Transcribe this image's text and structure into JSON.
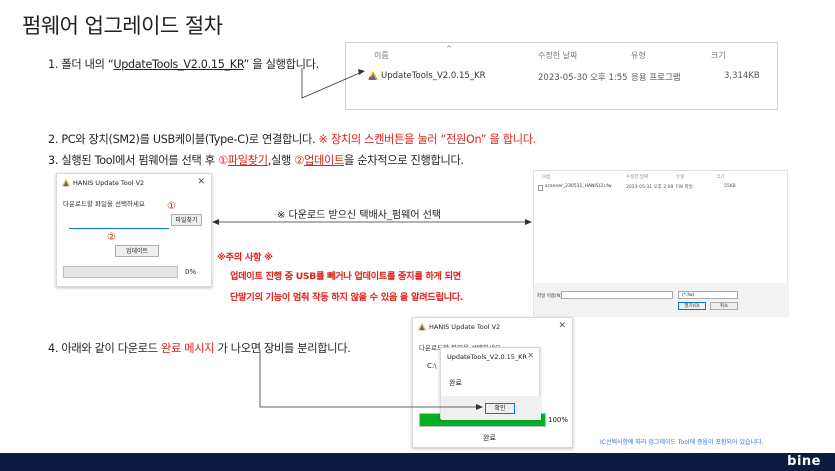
{
  "title": "펌웨어 업그레이드 절차",
  "step1": {
    "text_a": "1. 폴더 내의 “",
    "link": "UpdateTools_V2.0.15_KR",
    "text_b": "” 을 실행합니다."
  },
  "explorer": {
    "col_name": "이름",
    "col_date": "수정한 날짜",
    "col_type": "유형",
    "col_size": "크기",
    "file_name": "UpdateTools_V2.0.15_KR",
    "file_date": "2023-05-30 오후 1:55",
    "file_type": "응용 프로그램",
    "file_size": "3,314KB"
  },
  "step2": {
    "text": "2. PC와 장치(SM2)를 USB케이블(Type-C)로 연결합니다.",
    "warning": "※ 장치의 스캔버튼을 눌러 “전원On” 을 합니다."
  },
  "step3": {
    "text_a": "3. 실행된 Tool에서 펌웨어를 선택 후 ",
    "mark1": "①",
    "link1": "파일찾기",
    "text_b": ",실행 ",
    "mark2": "②",
    "link2": "업데이트",
    "text_c": "을 순차적으로 진행합니다."
  },
  "tool_window": {
    "title": "HANIS Update Tool V2",
    "instruction": "다운로드할 파일을 선택하세요",
    "mark1": "①",
    "find_button": "파일찾기",
    "mark2": "②",
    "update_button": "업데이트",
    "progress_text": "0%",
    "progress_value": 0
  },
  "download_label": "※ 다운로드 받으신 택배사_펌웨어 선택",
  "file_dialog": {
    "col_name": "이름",
    "col_date": "수정한 날짜",
    "col_type": "유형",
    "col_size": "크기",
    "file_name": "scanner_230531_HANIS(2).fw",
    "file_date": "2023-05-31 오후 2:09",
    "file_type": "FW 파일",
    "file_size": "55KB",
    "filename_label": "파일 이름(N):",
    "filter": "(*.fw)",
    "open_button": "열기(O)",
    "cancel_button": "취소"
  },
  "caution": {
    "title": "※주의 사항 ※",
    "line1": "업데이트 진행 중 USB를 빼거나 업데이트를 중지를 하게 되면",
    "line2": "단말기의 기능이 멈춰 작동 하지 않을 수 있음 을 알려드립니다."
  },
  "step4": {
    "text_a": "4. 아래와 같이 다운로드 ",
    "highlight": "완료 메시지",
    "text_b": " 가 나오면 장비를 분리합니다."
  },
  "done_window": {
    "title": "HANIS Update Tool V2",
    "instruction": "다운로드할 파일을 선택하세요",
    "path_prefix": "C:\\",
    "progress_text": "100%",
    "progress_value": 100,
    "status": "완료"
  },
  "done_popup": {
    "title": "UpdateTools_V2.0.15_KR",
    "message": "완료",
    "ok_button": "확인"
  },
  "footnote": "IC선택사항에 따라 업그레이드 Tool에 증음이 포함되어 있습니다.",
  "logo": "bine"
}
